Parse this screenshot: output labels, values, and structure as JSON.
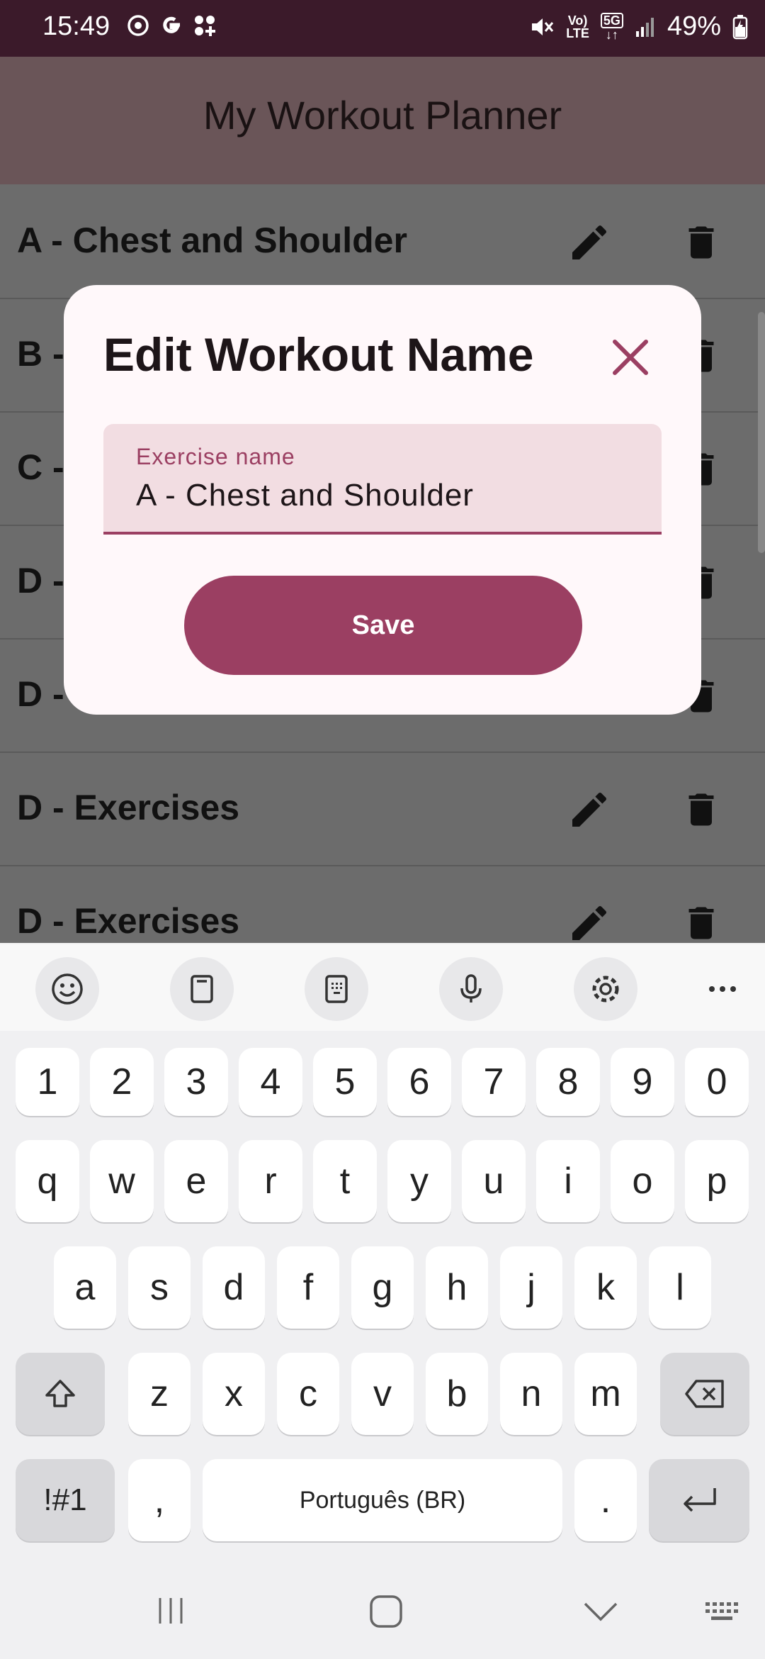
{
  "status_bar": {
    "time": "15:49",
    "lte_top": "Vo)",
    "lte_bottom": "LTE",
    "net_type": "5G",
    "battery": "49%"
  },
  "app_bar": {
    "title": "My Workout Planner"
  },
  "workouts": [
    {
      "label": "A - Chest and Shoulder"
    },
    {
      "label": "B -"
    },
    {
      "label": "C -"
    },
    {
      "label": "D -"
    },
    {
      "label": "D -"
    },
    {
      "label": "D - Exercises"
    },
    {
      "label": "D - Exercises"
    }
  ],
  "dialog": {
    "title": "Edit Workout Name",
    "field_label": "Exercise name",
    "field_value": "A - Chest and Shoulder",
    "save_label": "Save"
  },
  "keyboard": {
    "toolbar": [
      "emoji-icon",
      "clipboard-icon",
      "keypad-icon",
      "microphone-icon",
      "settings-icon",
      "more-icon"
    ],
    "row_numbers": [
      "1",
      "2",
      "3",
      "4",
      "5",
      "6",
      "7",
      "8",
      "9",
      "0"
    ],
    "row_1": [
      "q",
      "w",
      "e",
      "r",
      "t",
      "y",
      "u",
      "i",
      "o",
      "p"
    ],
    "row_2": [
      "a",
      "s",
      "d",
      "f",
      "g",
      "h",
      "j",
      "k",
      "l"
    ],
    "row_3": [
      "z",
      "x",
      "c",
      "v",
      "b",
      "n",
      "m"
    ],
    "symbols_label": "!#1",
    "comma_label": ",",
    "space_label": "Português (BR)",
    "period_label": "."
  },
  "colors": {
    "accent": "#9b3f62",
    "status_bar": "#3b1a2a",
    "app_bar": "#6a5558",
    "dialog_bg": "#fff8fa",
    "field_bg": "#f2dde2"
  }
}
